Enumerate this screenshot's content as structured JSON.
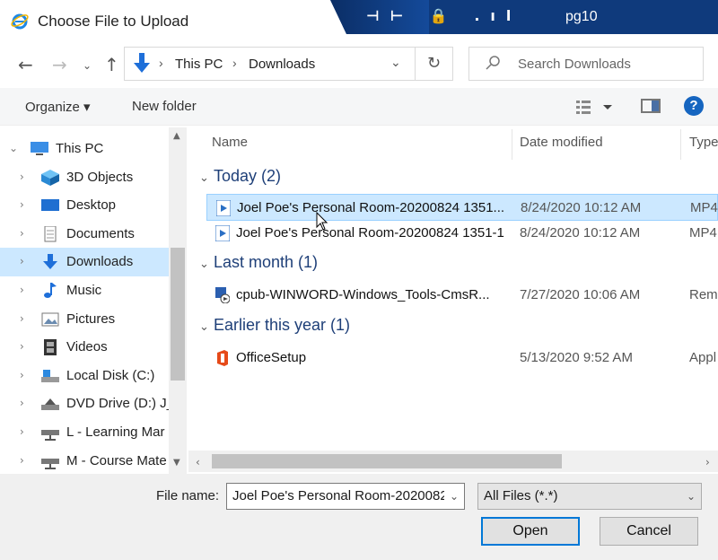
{
  "window": {
    "title": "Choose File to Upload",
    "remote_host": "pg10",
    "remote_icons": "⊣⊢ 🔒 .ıl"
  },
  "address": {
    "crumbs": [
      "This PC",
      "Downloads"
    ],
    "search_placeholder": "Search Downloads"
  },
  "toolbar": {
    "organize_label": "Organize ▾",
    "new_folder_label": "New folder",
    "help_label": "?"
  },
  "nav": {
    "items": [
      {
        "label": "This PC",
        "icon": "computer-icon",
        "chevron": "⌄"
      },
      {
        "label": "3D Objects",
        "icon": "cube-icon",
        "chevron": "›"
      },
      {
        "label": "Desktop",
        "icon": "desktop-icon",
        "chevron": "›"
      },
      {
        "label": "Documents",
        "icon": "documents-icon",
        "chevron": "›"
      },
      {
        "label": "Downloads",
        "icon": "download-icon",
        "chevron": "›"
      },
      {
        "label": "Music",
        "icon": "music-icon",
        "chevron": "›"
      },
      {
        "label": "Pictures",
        "icon": "pictures-icon",
        "chevron": "›"
      },
      {
        "label": "Videos",
        "icon": "videos-icon",
        "chevron": "›"
      },
      {
        "label": "Local Disk (C:)",
        "icon": "disk-icon",
        "chevron": "›"
      },
      {
        "label": "DVD Drive (D:) J_",
        "icon": "dvd-icon",
        "chevron": "›"
      },
      {
        "label": "L - Learning Mar",
        "icon": "network-drive-icon",
        "chevron": "›"
      },
      {
        "label": "M - Course Mate",
        "icon": "network-drive-icon",
        "chevron": "›"
      }
    ],
    "selected_index": 4
  },
  "columns": {
    "name": "Name",
    "date": "Date modified",
    "type": "Type"
  },
  "groups": [
    {
      "title": "Today (2)",
      "files": [
        {
          "name": "Joel Poe's Personal Room-20200824 1351...",
          "date": "8/24/2020 10:12 AM",
          "type": "MP4",
          "icon": "video-file-icon",
          "selected": true
        },
        {
          "name": "Joel Poe's Personal Room-20200824 1351-1",
          "date": "8/24/2020 10:12 AM",
          "type": "MP4",
          "icon": "video-file-icon",
          "selected": false
        }
      ]
    },
    {
      "title": "Last month (1)",
      "files": [
        {
          "name": "cpub-WINWORD-Windows_Tools-CmsR...",
          "date": "7/27/2020 10:06 AM",
          "type": "Rem",
          "icon": "remote-app-icon",
          "selected": false
        }
      ]
    },
    {
      "title": "Earlier this year (1)",
      "files": [
        {
          "name": "OfficeSetup",
          "date": "5/13/2020 9:52 AM",
          "type": "Appl",
          "icon": "office-icon",
          "selected": false
        }
      ]
    }
  ],
  "footer": {
    "file_name_label": "File name:",
    "file_name_value": "Joel Poe's Personal Room-2020082",
    "filter_value": "All Files (*.*)",
    "open_label": "Open",
    "cancel_label": "Cancel"
  }
}
